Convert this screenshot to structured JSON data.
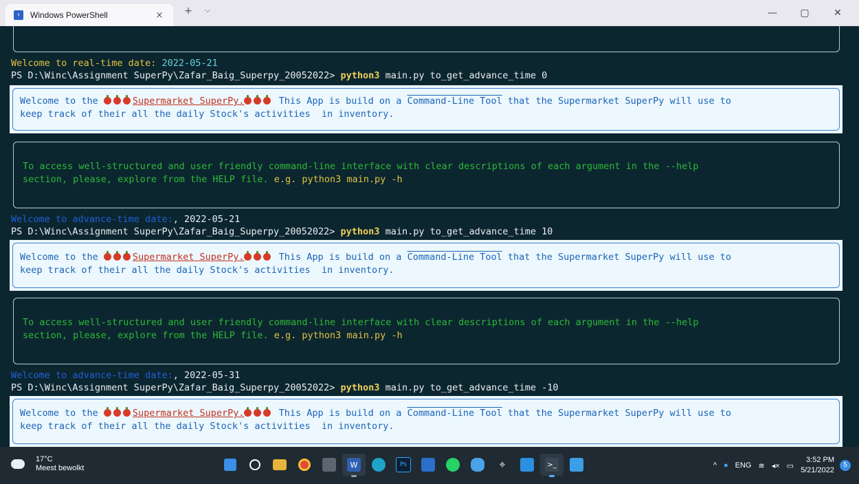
{
  "window": {
    "tab_title": "Windows PowerShell",
    "tab_close": "×",
    "new_tab": "+",
    "dropdown": "⌵",
    "minimize": "—",
    "maximize": "▢",
    "close": "✕"
  },
  "terminal": {
    "line1_label": "Welcome to real-time date:",
    "line1_date": " 2022-05-21",
    "prompt": "PS D:\\Winc\\Assignment SuperPy\\Zafar_Baig_Superpy_20052022> ",
    "cmd": "python3",
    "args1": " main.py to_get_advance_time 0",
    "args2": " main.py to_get_advance_time 10",
    "args3": " main.py to_get_advance_time -10",
    "welcome_pre": "Welcome to the ",
    "welcome_brand": "Supermarket SuperPy.",
    "welcome_mid": " This App is build on a ",
    "welcome_tool": "Command-Line Tool",
    "welcome_post": " that the Supermarket SuperPy will use to",
    "welcome_line2": "keep track of their all the daily Stock's activities  in inventory.",
    "help_line1": "To access well-structured and user friendly command-line interface with clear descriptions of each argument in the --help",
    "help_line2": "section, please, explore from the HELP file. ",
    "help_example": "e.g. python3 main.py -h",
    "adv_label": "Welcome to advance-time date:",
    "adv_date1": ", 2022-05-21",
    "adv_date2": ", 2022-05-31"
  },
  "taskbar": {
    "temp": "17°C",
    "weather": "Meest bewolkt",
    "lang": "ENG",
    "time": "3:52 PM",
    "date": "5/21/2022",
    "notifications": "5"
  }
}
